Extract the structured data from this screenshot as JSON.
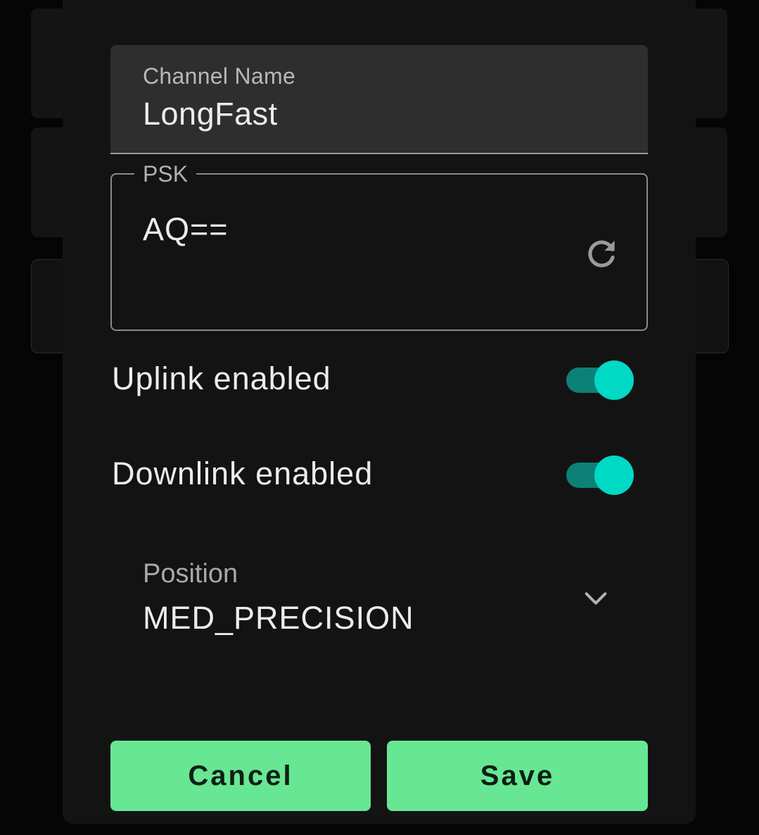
{
  "channel_name": {
    "label": "Channel Name",
    "value": "LongFast"
  },
  "psk": {
    "label": "PSK",
    "value": "AQ==",
    "action_icon": "refresh-icon"
  },
  "uplink": {
    "label": "Uplink enabled",
    "enabled": true
  },
  "downlink": {
    "label": "Downlink enabled",
    "enabled": true
  },
  "position": {
    "label": "Position",
    "value": "MED_PRECISION",
    "icon": "chevron-down-icon"
  },
  "actions": {
    "cancel_label": "Cancel",
    "save_label": "Save"
  },
  "colors": {
    "accent_button": "#67e794",
    "switch_thumb": "#00d9c4",
    "switch_track": "#0d8178",
    "dialog_background": "#131313"
  }
}
